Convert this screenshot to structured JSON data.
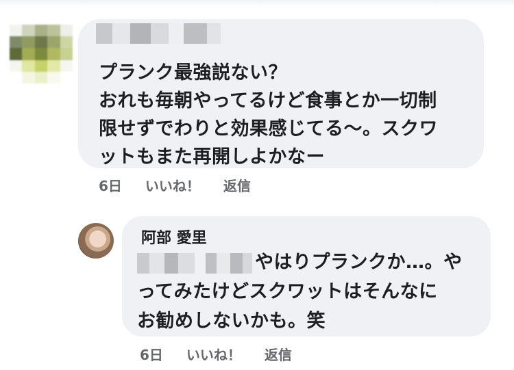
{
  "comment": {
    "lines": [
      "プランク最強説ない？",
      "おれも毎朝やってるけど食事とか一切制",
      "限せずでわりと効果感じてる〜。スクワ",
      "ットもまた再開しよかなー"
    ],
    "time": "6日",
    "like_label": "いいね！",
    "reply_label": "返信"
  },
  "reply": {
    "author": "阿部 愛里",
    "line1_text": "やはりプランクか…。や",
    "lines": [
      "ってみたけどスクワットはそんなに",
      "お勧めしないかも。笑"
    ],
    "time": "6日",
    "like_label": "いいね！",
    "reply_label": "返信"
  },
  "colors": {
    "bubble": "#f0f1f4",
    "text": "#1c1e21",
    "meta": "#65676b"
  }
}
